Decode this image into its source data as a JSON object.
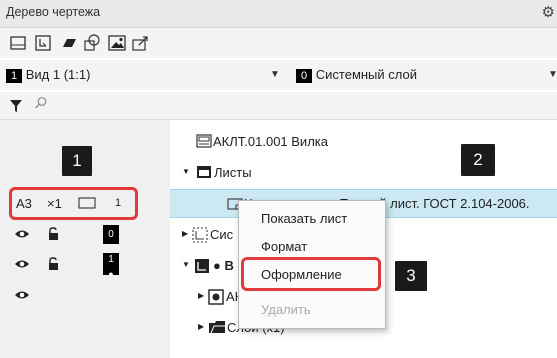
{
  "window": {
    "title": "Дерево чертежа"
  },
  "toolbar": {
    "icons": [
      "frame-icon",
      "view-icon",
      "layer-icon",
      "object-icon",
      "image-icon",
      "export-icon"
    ]
  },
  "combos": {
    "view": {
      "number": "1",
      "label": "Вид 1 (1:1)"
    },
    "layer": {
      "number": "0",
      "label": "Системный слой"
    }
  },
  "search": {
    "placeholder": ""
  },
  "tree": {
    "document": "АКЛТ.01.001 Вилка",
    "sheets_folder": "Листы",
    "sheet_item": "Чертеж констр. Первый лист. ГОСТ 2.104-2006.",
    "system_view": "Сис",
    "view_bold": "В",
    "view_child_doc": "АК",
    "layers": "Слои (х1)"
  },
  "left_panel": {
    "sheet_format": "А3",
    "sheet_mult": "×1",
    "sheet_number": "1",
    "row1_layer_num": "0",
    "row2_layer_num": "1"
  },
  "context_menu": {
    "items": [
      {
        "label": "Показать лист",
        "enabled": true
      },
      {
        "label": "Формат",
        "enabled": true
      },
      {
        "label": "Оформление",
        "enabled": true
      },
      {
        "label": "Удалить",
        "enabled": false
      }
    ]
  },
  "callouts": {
    "c1": "1",
    "c2": "2",
    "c3": "3"
  },
  "colors": {
    "selected_row": "#cbe8f3",
    "callout_border": "#e03a3a",
    "callout_bg": "#1a1a1a"
  }
}
